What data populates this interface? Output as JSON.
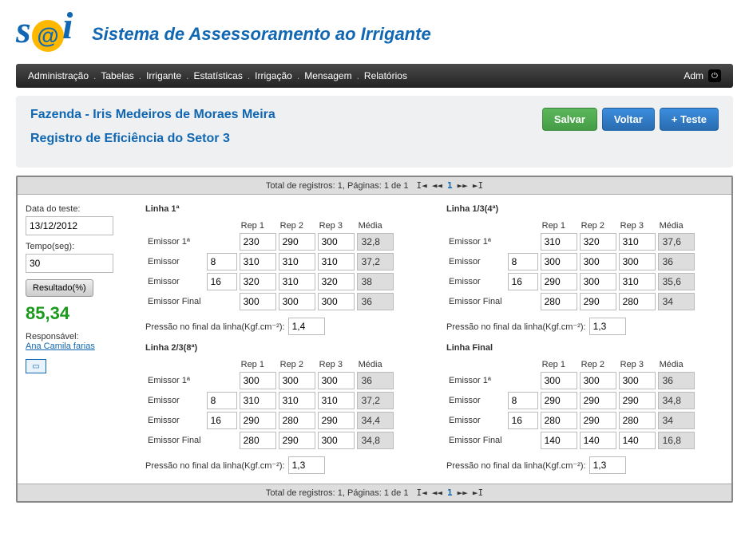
{
  "brand": "Sistema de Assessoramento ao Irrigante",
  "nav": {
    "items": [
      "Administração",
      "Tabelas",
      "Irrigante",
      "Estatísticas",
      "Irrigação",
      "Mensagem",
      "Relatórios"
    ],
    "user": "Adm"
  },
  "page": {
    "title1": "Fazenda - Iris Medeiros de Moraes Meira",
    "title2": "Registro de Eficiência do Setor 3",
    "btn_save": "Salvar",
    "btn_back": "Voltar",
    "btn_add": "+ Teste"
  },
  "pager": {
    "text": "Total de registros: 1, Páginas: 1 de 1",
    "page": "1"
  },
  "left": {
    "date_label": "Data do teste:",
    "date": "13/12/2012",
    "time_label": "Tempo(seg):",
    "time": "30",
    "result_btn": "Resultado(%)",
    "result": "85,34",
    "resp_label": "Responsável:",
    "resp_name": "Ana Camila farias"
  },
  "cols": {
    "rep1": "Rep 1",
    "rep2": "Rep 2",
    "rep3": "Rep 3",
    "media": "Média"
  },
  "rows": {
    "e1": "Emissor 1ª",
    "e": "Emissor",
    "ef": "Emissor Final"
  },
  "pressure_label": "Pressão no final da linha(Kgf.cm⁻²):",
  "lines": [
    {
      "title": "Linha 1ª",
      "e1": {
        "r": [
          "230",
          "290",
          "300"
        ],
        "m": "32,8"
      },
      "e2": {
        "n": "8",
        "r": [
          "310",
          "310",
          "310"
        ],
        "m": "37,2"
      },
      "e3": {
        "n": "16",
        "r": [
          "320",
          "310",
          "320"
        ],
        "m": "38"
      },
      "ef": {
        "r": [
          "300",
          "300",
          "300"
        ],
        "m": "36"
      },
      "pressure": "1,4"
    },
    {
      "title": "Linha 1/3(4ª)",
      "e1": {
        "r": [
          "310",
          "320",
          "310"
        ],
        "m": "37,6"
      },
      "e2": {
        "n": "8",
        "r": [
          "300",
          "300",
          "300"
        ],
        "m": "36"
      },
      "e3": {
        "n": "16",
        "r": [
          "290",
          "300",
          "310"
        ],
        "m": "35,6"
      },
      "ef": {
        "r": [
          "280",
          "290",
          "280"
        ],
        "m": "34"
      },
      "pressure": "1,3"
    },
    {
      "title": "Linha 2/3(8ª)",
      "e1": {
        "r": [
          "300",
          "300",
          "300"
        ],
        "m": "36"
      },
      "e2": {
        "n": "8",
        "r": [
          "310",
          "310",
          "310"
        ],
        "m": "37,2"
      },
      "e3": {
        "n": "16",
        "r": [
          "290",
          "280",
          "290"
        ],
        "m": "34,4"
      },
      "ef": {
        "r": [
          "280",
          "290",
          "300"
        ],
        "m": "34,8"
      },
      "pressure": "1,3"
    },
    {
      "title": "Linha Final",
      "e1": {
        "r": [
          "300",
          "300",
          "300"
        ],
        "m": "36"
      },
      "e2": {
        "n": "8",
        "r": [
          "290",
          "290",
          "290"
        ],
        "m": "34,8"
      },
      "e3": {
        "n": "16",
        "r": [
          "280",
          "290",
          "280"
        ],
        "m": "34"
      },
      "ef": {
        "r": [
          "140",
          "140",
          "140"
        ],
        "m": "16,8"
      },
      "pressure": "1,3"
    }
  ]
}
